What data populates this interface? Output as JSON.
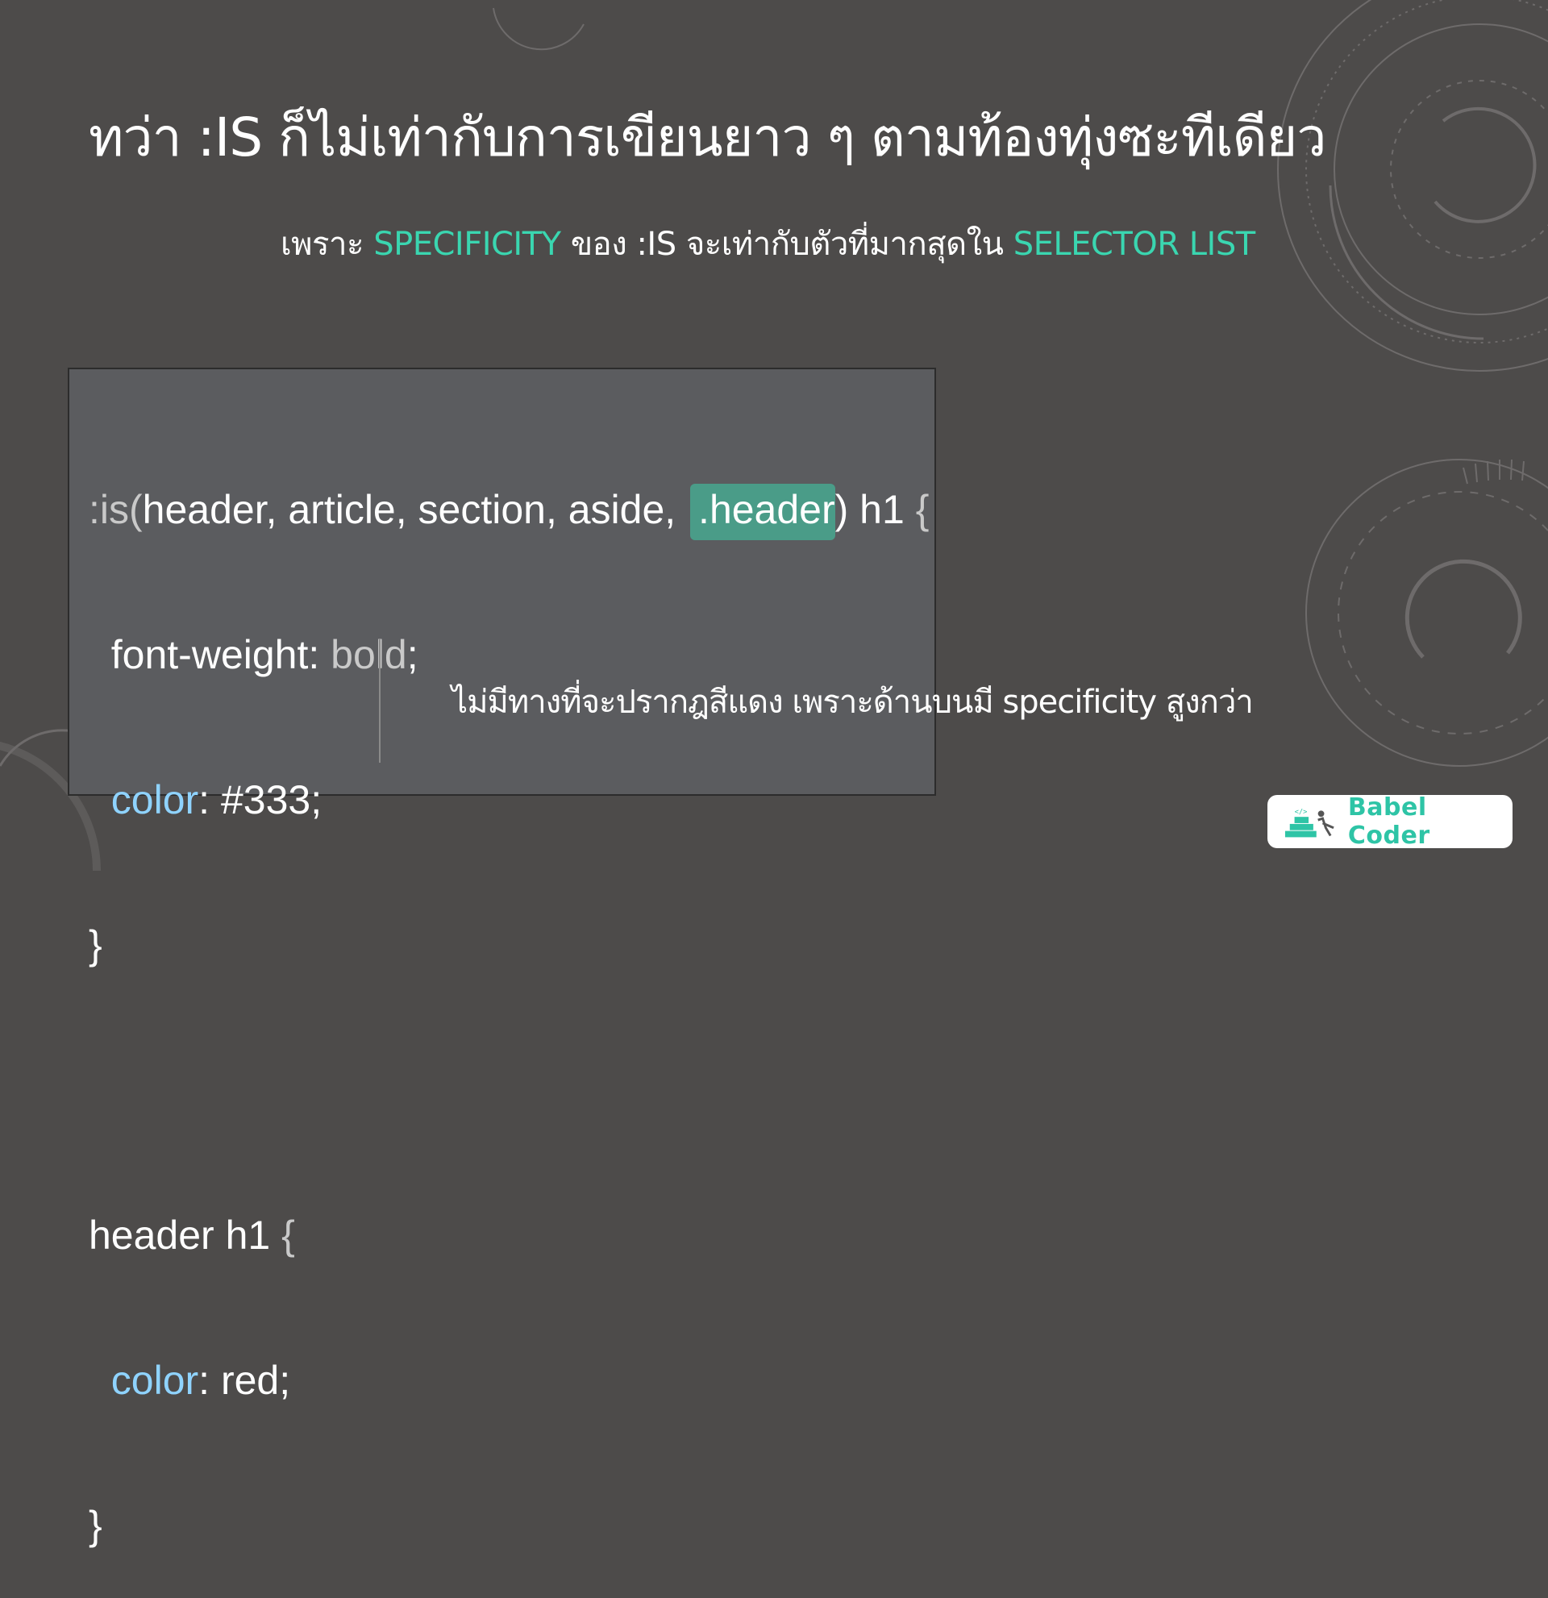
{
  "slide": {
    "title": "ทว่า :IS ก็ไม่เท่ากับการเขียนยาว ๆ ตามท้องทุ่งซะทีเดียว",
    "subtitle": {
      "prefix": "เพราะ ",
      "term1": "SPECIFICITY",
      "middle": " ของ :IS จะเท่ากับตัวที่มากสุดใน ",
      "term2": "SELECTOR LIST"
    },
    "note": "ไม่มีทางที่จะปรากฎสีแดง เพราะด้านบนมี specificity สูงกว่า"
  },
  "code": {
    "line1": {
      "is": ":is(",
      "list": "header, article, section, aside, ",
      "highlight": ".header",
      "tail": ") h1 ",
      "brace": "{"
    },
    "line2": {
      "prop": "  font-weight",
      "colon": ": ",
      "value": "bold",
      "semi": ";"
    },
    "line3": {
      "prop": "  color",
      "colon": ": ",
      "value": "#333;"
    },
    "line4": "}",
    "line6": {
      "selector": "header h1 ",
      "brace": "{"
    },
    "line7": {
      "prop": "  color",
      "colon": ": ",
      "value": "red;"
    },
    "line8": "}"
  },
  "logo": {
    "text": "Babel Coder"
  },
  "colors": {
    "background": "#4d4b4a",
    "accent": "#3ad6b0",
    "code_bg": "#5b5c5f",
    "highlight": "#4a9c88",
    "property": "#8fd3ff"
  }
}
